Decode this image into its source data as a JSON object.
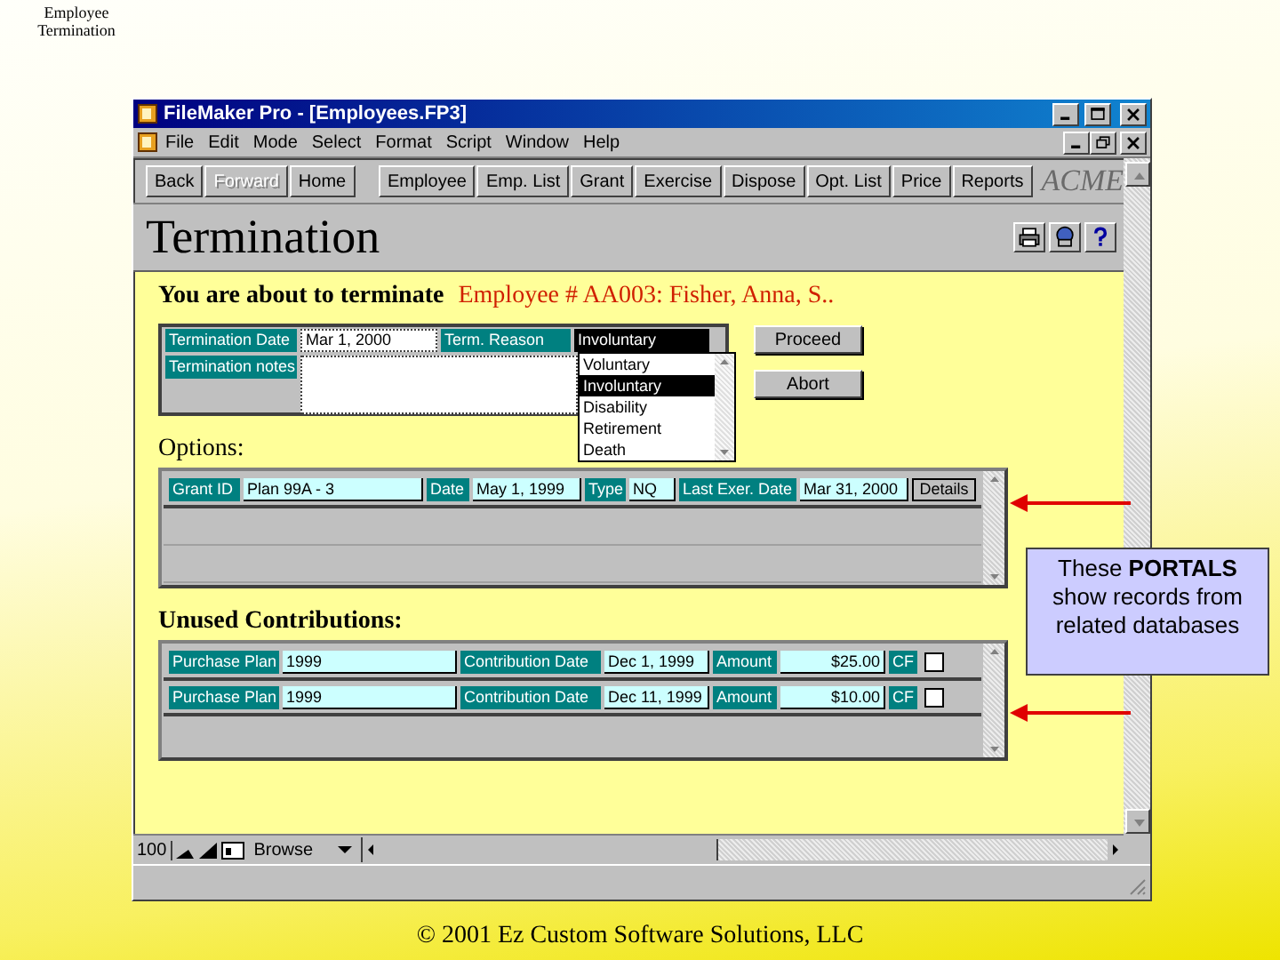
{
  "slide_title": "Employee Termination",
  "window": {
    "title": "FileMaker Pro - [Employees.FP3]"
  },
  "menu": [
    "File",
    "Edit",
    "Mode",
    "Select",
    "Format",
    "Script",
    "Window",
    "Help"
  ],
  "toolbar": {
    "nav_buttons": [
      {
        "label": "Back",
        "disabled": false
      },
      {
        "label": "Forward",
        "disabled": true
      },
      {
        "label": "Home",
        "disabled": false
      }
    ],
    "layout_buttons": [
      "Employee",
      "Emp. List",
      "Grant",
      "Exercise",
      "Dispose",
      "Opt. List",
      "Price",
      "Reports"
    ],
    "logo": "ACME"
  },
  "layout_title": "Termination",
  "prompt": {
    "text": "You are about to terminate",
    "employee": "Employee # AA003: Fisher, Anna, S.."
  },
  "form": {
    "termination_date": {
      "label": "Termination Date",
      "value": "Mar 1, 2000"
    },
    "term_reason": {
      "label": "Term. Reason",
      "value": "Involuntary",
      "options": [
        {
          "label": "Voluntary",
          "selected": false
        },
        {
          "label": "Involuntary",
          "selected": true
        },
        {
          "label": "Disability",
          "selected": false
        },
        {
          "label": "Retirement",
          "selected": false
        },
        {
          "label": "Death",
          "selected": false
        }
      ]
    },
    "notes": {
      "label": "Termination notes"
    }
  },
  "actions": [
    "Proceed",
    "Abort"
  ],
  "options": {
    "heading": "Options:",
    "rows": [
      {
        "fields": [
          {
            "label": "Grant ID",
            "value": "Plan 99A - 3"
          },
          {
            "label": "Date",
            "value": "May 1, 1999"
          },
          {
            "label": "Type",
            "value": "NQ"
          },
          {
            "label": "Last Exer. Date",
            "value": "Mar 31, 2000"
          }
        ],
        "button": "Details"
      }
    ]
  },
  "contributions": {
    "heading": "Unused Contributions:",
    "rows": [
      {
        "fields": [
          {
            "label": "Purchase Plan",
            "value": "1999"
          },
          {
            "label": "Contribution Date",
            "value": "Dec 1, 1999"
          },
          {
            "label": "Amount",
            "value": "$25.00"
          }
        ],
        "flag": "CF",
        "checked": false
      },
      {
        "fields": [
          {
            "label": "Purchase Plan",
            "value": "1999"
          },
          {
            "label": "Contribution Date",
            "value": "Dec 11, 1999"
          },
          {
            "label": "Amount",
            "value": "$10.00"
          }
        ],
        "flag": "CF",
        "checked": false
      }
    ]
  },
  "status": {
    "zoom": "100",
    "mode": "Browse"
  },
  "callout": "These **PORTALS** show records from related databases",
  "footer": "© 2001 Ez Custom Software Solutions, LLC"
}
